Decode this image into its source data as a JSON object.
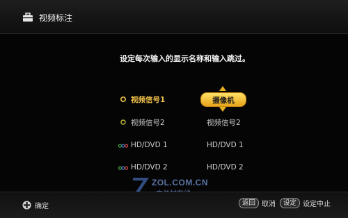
{
  "header": {
    "title": "视频标注",
    "icon": "toolbox-icon"
  },
  "prompt": "设定每次输入的显示名称和输入跳过。",
  "rows": [
    {
      "icon": "video-input-icon",
      "label": "视频信号1",
      "value": "摄像机",
      "selected": true
    },
    {
      "icon": "video-input-icon",
      "label": "视频信号2",
      "value": "视频信号2",
      "selected": false
    },
    {
      "icon": "component-input-icon",
      "label": "HD/DVD 1",
      "value": "HD/DVD 1",
      "selected": false
    },
    {
      "icon": "component-input-icon",
      "label": "HD/DVD 2",
      "value": "HD/DVD 2",
      "selected": false
    }
  ],
  "footer": {
    "left_icon": "dpad-icon",
    "left_label": "确定",
    "back_key": "返回",
    "back_label": "取消",
    "setup_key": "设定",
    "setup_label": "设定中止"
  },
  "watermark": {
    "en": "ZOL.COM.CN",
    "cn": "中关村在线"
  },
  "colors": {
    "accent": "#f2c24a",
    "selector": "#f4c030",
    "background": "#050505"
  }
}
